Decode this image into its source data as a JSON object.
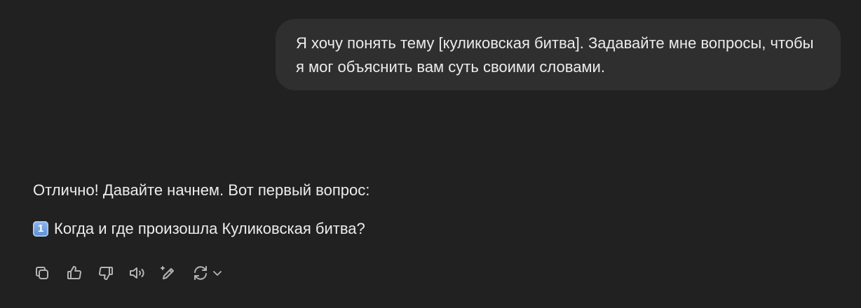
{
  "user_message": {
    "text": "Я хочу понять тему [куликовская битва]. Задавайте мне вопросы, чтобы я мог объяснить вам суть своими словами."
  },
  "assistant_message": {
    "line1": "Отлично! Давайте начнем. Вот первый вопрос:",
    "question_number": "1",
    "question": "Когда и где произошла Куликовская битва?"
  },
  "actions": {
    "icons": [
      "copy-icon",
      "thumbs-up-icon",
      "thumbs-down-icon",
      "read-aloud-icon",
      "edit-icon",
      "regenerate-icon",
      "chevron-down-icon"
    ]
  },
  "colors": {
    "background": "#212121",
    "bubble": "#2f2f2f",
    "text": "#ececec",
    "icon": "#b4b4b4"
  }
}
